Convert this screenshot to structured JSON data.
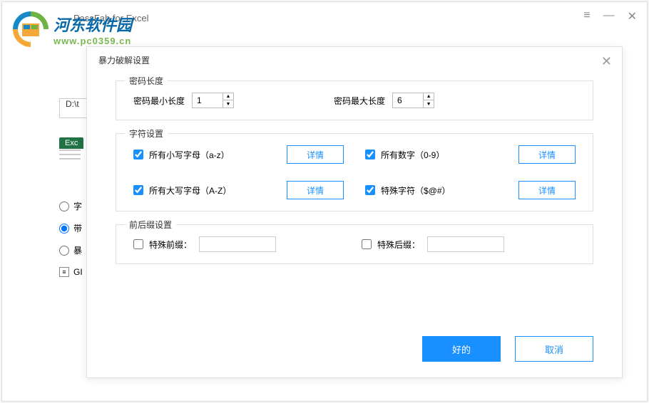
{
  "app": {
    "title": "PassFab for Excel"
  },
  "watermark": {
    "title": "河东软件园",
    "url": "www.pc0359.cn"
  },
  "bg": {
    "file_path": "D:\\t",
    "excel_label": "Exc",
    "radio1": "字",
    "radio2": "带",
    "radio3": "暴",
    "gpu": "GI"
  },
  "modal": {
    "title": "暴力破解设置",
    "sections": {
      "length": {
        "title": "密码长度",
        "min_label": "密码最小长度",
        "min_value": "1",
        "max_label": "密码最大长度",
        "max_value": "6"
      },
      "charset": {
        "title": "字符设置",
        "lowercase": "所有小写字母（a-z）",
        "uppercase": "所有大写字母（A-Z）",
        "digits": "所有数字（0-9）",
        "special": "特殊字符（$@#）",
        "detail_label": "详情"
      },
      "affix": {
        "title": "前后缀设置",
        "prefix": "特殊前缀：",
        "suffix": "特殊后缀："
      }
    },
    "buttons": {
      "ok": "好的",
      "cancel": "取消"
    }
  }
}
